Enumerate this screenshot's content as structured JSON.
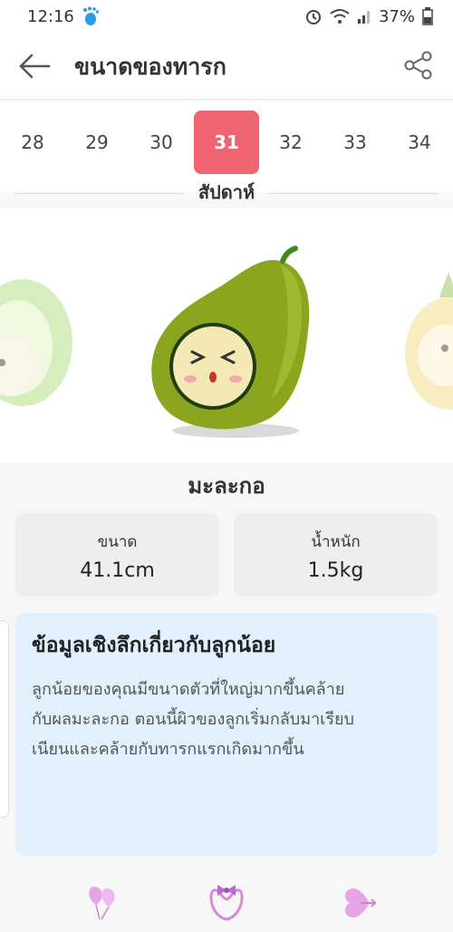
{
  "status": {
    "time": "12:16",
    "battery": "37%"
  },
  "appbar": {
    "title": "ขนาดของทารก"
  },
  "weeks": {
    "items": [
      "28",
      "29",
      "30",
      "31",
      "32",
      "33",
      "34"
    ],
    "selected": "31",
    "label": "สัปดาห์"
  },
  "fruit": {
    "name": "มะละกอ"
  },
  "size_card": {
    "label": "ขนาด",
    "value": "41.1cm"
  },
  "weight_card": {
    "label": "น้ำหนัก",
    "value": "1.5kg"
  },
  "insight": {
    "title": "ข้อมูลเชิงลึกเกี่ยวกับลูกน้อย",
    "lines": [
      "ลูกน้อยของคุณมีขนาดตัวที่ใหญ่มากขึ้นคล้าย",
      "กับผลมะละกอ ตอนนี้ผิวของลูกเริ่มกลับมาเรียบ",
      "เนียนและคล้ายกับทารกแรกเกิดมากขึ้น"
    ]
  },
  "colors": {
    "accent": "#f0646f",
    "insight_bg": "#e1f0fc",
    "papaya": "#8aa61f",
    "icon_pink": "#e6a3e6"
  }
}
